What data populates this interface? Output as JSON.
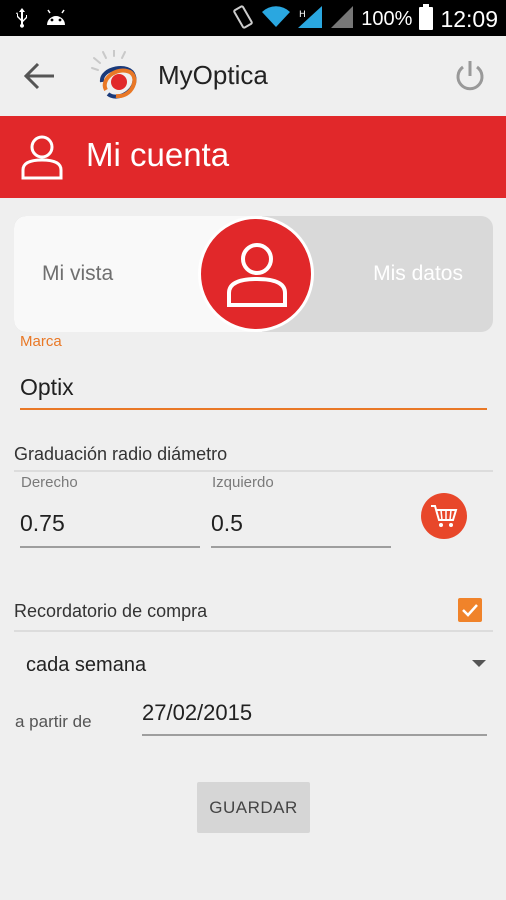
{
  "status_bar": {
    "battery_percent": "100%",
    "time": "12:09",
    "icons": [
      "usb-icon",
      "android-icon",
      "vibrate-icon",
      "wifi-icon",
      "signal-icon",
      "signal-icon",
      "battery-icon"
    ]
  },
  "app_bar": {
    "title": "MyOptica",
    "icons": [
      "back-arrow-icon",
      "myoptica-logo",
      "power-icon"
    ]
  },
  "header": {
    "title": "Mi cuenta",
    "icon": "user-icon"
  },
  "view_toggle": {
    "left_label": "Mi vista",
    "right_label": "Mis datos",
    "knob_icon": "user-icon"
  },
  "form": {
    "marca_label": "Marca",
    "marca_value": "Optix",
    "graduacion_title": "Graduación radio diámetro",
    "derecho_label": "Derecho",
    "derecho_value": "0.75",
    "izquierdo_label": "Izquierdo",
    "izquierdo_value": "0.5",
    "cart_icon": "shopping-cart-icon",
    "recordatorio_label": "Recordatorio de compra",
    "recordatorio_checked": true,
    "frequency_selected": "cada semana",
    "partir_label": "a partir de",
    "partir_value": "27/02/2015",
    "save_button": "GUARDAR"
  },
  "colors": {
    "brand_red": "#e1282a",
    "accent_orange": "#e97826",
    "background": "#efefef"
  }
}
